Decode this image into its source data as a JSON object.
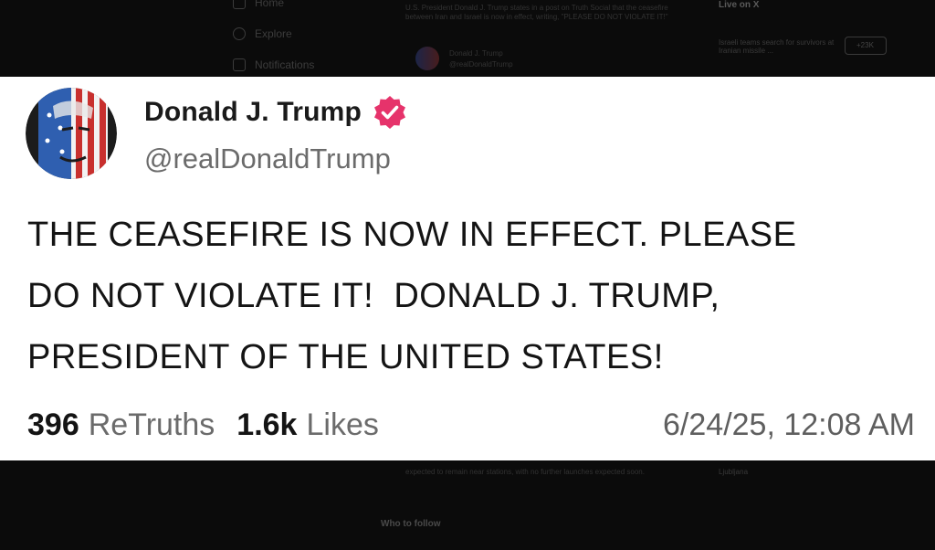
{
  "background": {
    "nav_items": [
      "Home",
      "Explore",
      "Notifications"
    ],
    "news_snippet": "U.S. President Donald J. Trump states in a post on Truth Social that the ceasefire between Iran and Israel is now in effect, writing, \"PLEASE DO NOT VIOLATE IT!\"",
    "embedded_name": "Donald J. Trump",
    "embedded_handle": "@realDonaldTrump",
    "live_title": "Live on X",
    "live_item": "Israeli teams search for survivors at Iranian missile ...",
    "live_count": "+23K",
    "bottom_snippet": "expected to remain near stations, with no further launches expected soon.",
    "who_to_follow": "Who to follow",
    "side_item": "Ljubljana"
  },
  "post": {
    "author_name": "Donald J. Trump",
    "handle": "@realDonaldTrump",
    "verified": true,
    "verified_color": "#e6336b",
    "text": "THE CEASEFIRE IS NOW IN EFFECT. PLEASE\nDO NOT VIOLATE IT!  DONALD J. TRUMP,\nPRESIDENT OF THE UNITED STATES!",
    "retruths_count": "396",
    "retruths_label": "ReTruths",
    "likes_count": "1.6k",
    "likes_label": "Likes",
    "timestamp": "6/24/25, 12:08 AM"
  }
}
